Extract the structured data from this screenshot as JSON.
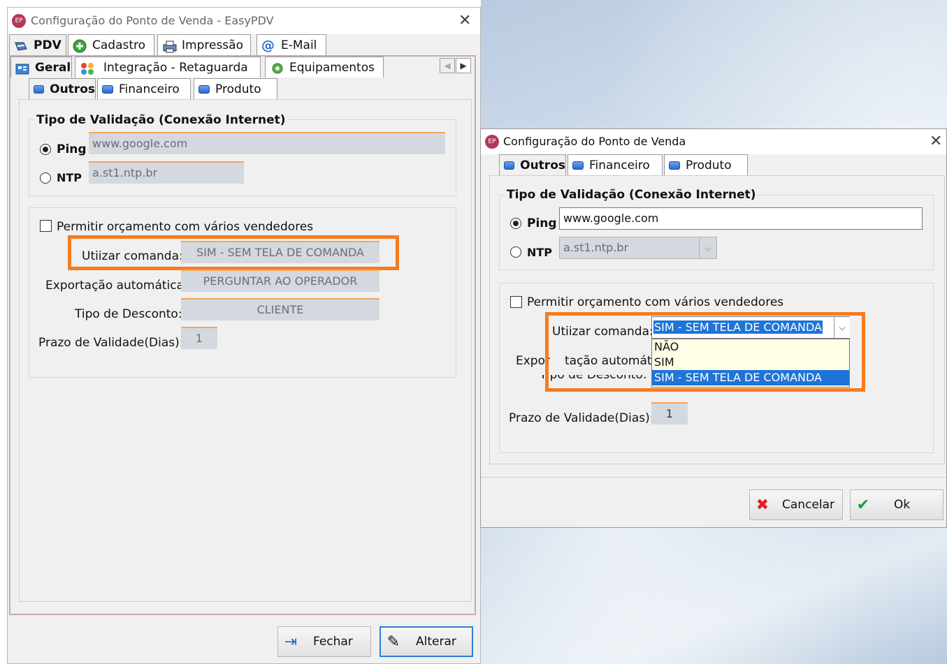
{
  "back_window": {
    "title": "Configuração do Ponto de Venda - EasyPDV",
    "app_icon": "EP",
    "tabs_row1": [
      "PDV",
      "Cadastro",
      "Impressão",
      "E-Mail"
    ],
    "tabs_row2": [
      "Geral",
      "Integração - Retaguarda",
      "Equipamentos"
    ],
    "tabs_row3": [
      "Outros",
      "Financeiro",
      "Produto"
    ],
    "group_title": "Tipo de Validação (Conexão Internet)",
    "ping_label": "Ping",
    "ping_value": "www.google.com",
    "ntp_label": "NTP",
    "ntp_value": "a.st1.ntp.br",
    "checkbox_label": "Permitir orçamento com vários vendedores",
    "comanda_label": "Utiizar comanda:",
    "comanda_value": "SIM - SEM TELA DE COMANDA",
    "export_label": "Exportação automática:",
    "export_value": "PERGUNTAR AO OPERADOR",
    "discount_label": "Tipo de Desconto:",
    "discount_value": "CLIENTE",
    "validity_label": "Prazo de Validade(Dias):",
    "validity_value": "1",
    "btn_close": "Fechar",
    "btn_edit": "Alterar"
  },
  "front_window": {
    "title": "Configuração do Ponto de Venda",
    "app_icon": "EP",
    "tabs": [
      "Outros",
      "Financeiro",
      "Produto"
    ],
    "group_title": "Tipo de Validação (Conexão Internet)",
    "ping_label": "Ping",
    "ping_value": "www.google.com",
    "ntp_label": "NTP",
    "ntp_value": "a.st1.ntp.br",
    "checkbox_label": "Permitir orçamento com vários vendedores",
    "comanda_label": "Utiizar comanda:",
    "comanda_value": "SIM - SEM TELA DE COMANDA",
    "comanda_options": [
      "NÃO",
      "SIM",
      "SIM - SEM TELA DE COMANDA"
    ],
    "export_label_part1": "Expor",
    "export_label_part2": "tação automática:",
    "discount_label_partial": "Tipo de Desconto:",
    "validity_label": "Prazo de Validade(Dias):",
    "validity_value": "1",
    "btn_cancel": "Cancelar",
    "btn_ok": "Ok"
  },
  "colors": {
    "highlight_frame": "#f57c20",
    "selection": "#1e74d8",
    "disabled_field": "#d4d9df",
    "title_icon": "#b23a57"
  }
}
